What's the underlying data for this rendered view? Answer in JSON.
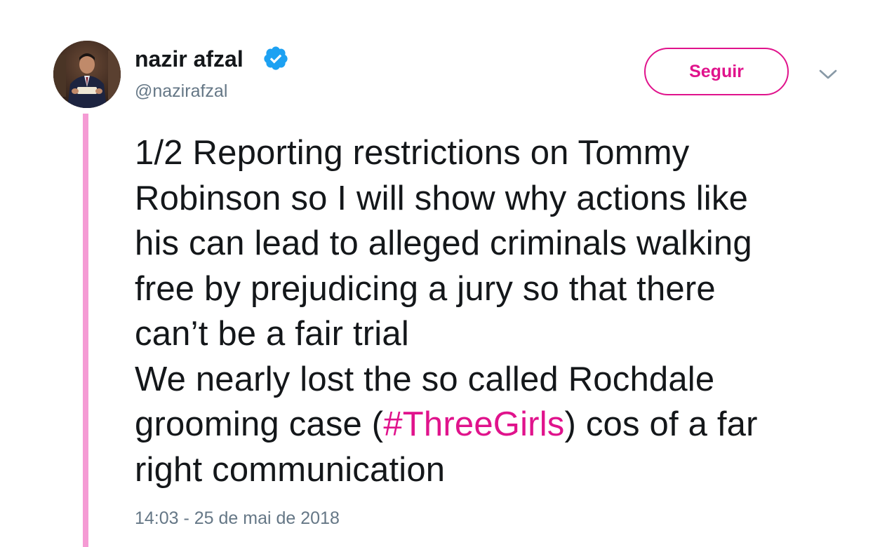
{
  "author": {
    "display_name": "nazir afzal",
    "handle": "@nazirafzal",
    "verified": true,
    "verified_icon": "verified-badge-icon",
    "avatar_icon": "profile-photo"
  },
  "actions": {
    "follow_label": "Seguir",
    "more_icon": "chevron-down-icon"
  },
  "tweet": {
    "lines": [
      "1/2 Reporting restrictions on Tommy",
      "Robinson so I will show why actions like",
      "his can lead to alleged criminals walking",
      "free by prejudicing a jury so that there",
      "can’t be a fair trial",
      "We nearly lost the so called Rochdale"
    ],
    "line7_before": "grooming case (",
    "hashtag": "#ThreeGirls",
    "line7_after": ") cos of a far",
    "line8": "right communication",
    "timestamp": "14:03 - 25 de mai de 2018"
  },
  "colors": {
    "accent": "#e0138c",
    "thread_line": "#f59bd4",
    "verified": "#1da1f2",
    "text": "#14171a",
    "muted": "#657786"
  }
}
